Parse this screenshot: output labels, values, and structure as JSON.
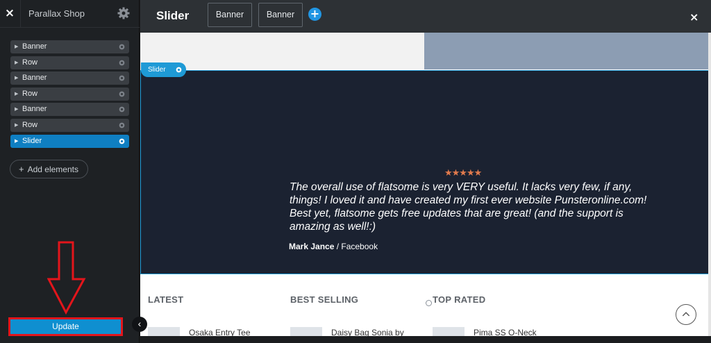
{
  "sidebar": {
    "close_label": "×",
    "site_title": "Parallax Shop",
    "tree": [
      {
        "label": "Banner",
        "active": false
      },
      {
        "label": "Row",
        "active": false
      },
      {
        "label": "Banner",
        "active": false
      },
      {
        "label": "Row",
        "active": false
      },
      {
        "label": "Banner",
        "active": false
      },
      {
        "label": "Row",
        "active": false
      },
      {
        "label": "Slider",
        "active": true
      }
    ],
    "add_elements_label": "Add elements",
    "update_label": "Update",
    "collapse_icon": "‹"
  },
  "topbar": {
    "title": "Slider",
    "tabs": [
      "Banner",
      "Banner"
    ],
    "add_label": "+",
    "close_label": "×"
  },
  "canvas": {
    "slider_tag": "Slider",
    "rating_stars": "★★★★★",
    "quote": "The overall use of flatsome is very VERY useful. It lacks very few, if any, things! I loved it and have created my first ever website Punsteronline.com! Best yet, flatsome gets free updates that are great! (and the support is amazing as well!:)",
    "author_name": "Mark Jance",
    "author_source": " / Facebook",
    "columns": [
      {
        "heading": "LATEST",
        "product": "Osaka Entry Tee"
      },
      {
        "heading": "BEST SELLING",
        "product": "Daisy Bag Sonia by"
      },
      {
        "heading": "TOP RATED",
        "product": "Pima SS O-Neck"
      }
    ]
  },
  "colors": {
    "accent": "#1e9ad6",
    "update_border": "#e3151b",
    "slider_bg": "#1b2231",
    "stars": "#e07a4d"
  }
}
